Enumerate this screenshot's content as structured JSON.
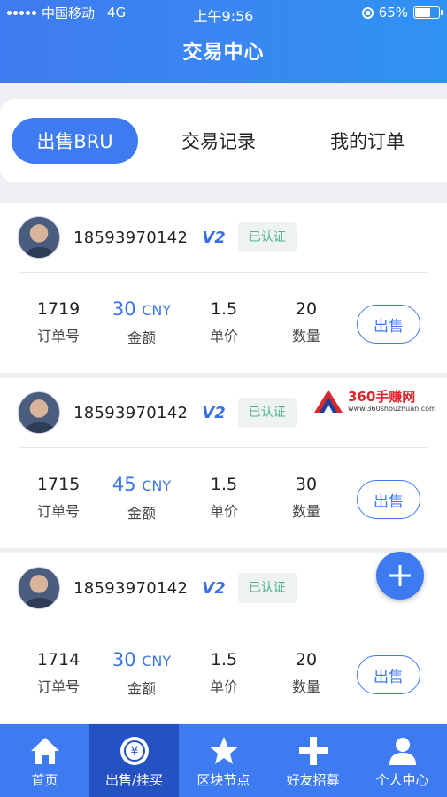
{
  "status_bar": {
    "carrier": "中国移动",
    "network": "4G",
    "time": "上午9:56",
    "battery_text": "65%",
    "battery_level": 0.65
  },
  "header": {
    "title": "交易中心"
  },
  "tabs": [
    {
      "label": "出售BRU",
      "active": true
    },
    {
      "label": "交易记录",
      "active": false
    },
    {
      "label": "我的订单",
      "active": false
    }
  ],
  "orders": [
    {
      "phone": "18593970142",
      "level": "V2",
      "verified": "已认证",
      "order_no": "1719",
      "amount": "30",
      "currency": "CNY",
      "price": "1.5",
      "quantity": "20",
      "action": "出售"
    },
    {
      "phone": "18593970142",
      "level": "V2",
      "verified": "已认证",
      "order_no": "1715",
      "amount": "45",
      "currency": "CNY",
      "price": "1.5",
      "quantity": "30",
      "action": "出售"
    },
    {
      "phone": "18593970142",
      "level": "V2",
      "verified": "已认证",
      "order_no": "1714",
      "amount": "30",
      "currency": "CNY",
      "price": "1.5",
      "quantity": "20",
      "action": "出售"
    }
  ],
  "labels": {
    "order_no": "订单号",
    "amount": "金额",
    "price": "单价",
    "quantity": "数量"
  },
  "watermark": {
    "brand": "360手赚网",
    "url": "www.360shouzhuan.com"
  },
  "nav": [
    {
      "label": "首页",
      "icon": "home-icon",
      "active": false
    },
    {
      "label": "出售/挂买",
      "icon": "yen-coin-icon",
      "active": true
    },
    {
      "label": "区块节点",
      "icon": "star-icon",
      "active": false
    },
    {
      "label": "好友招募",
      "icon": "plus-icon",
      "active": false
    },
    {
      "label": "个人中心",
      "icon": "user-icon",
      "active": false
    }
  ],
  "colors": {
    "primary": "#3f7bf0",
    "nav_active": "#2452c2",
    "amount": "#3a76ea",
    "verified": "#4fb58e"
  }
}
